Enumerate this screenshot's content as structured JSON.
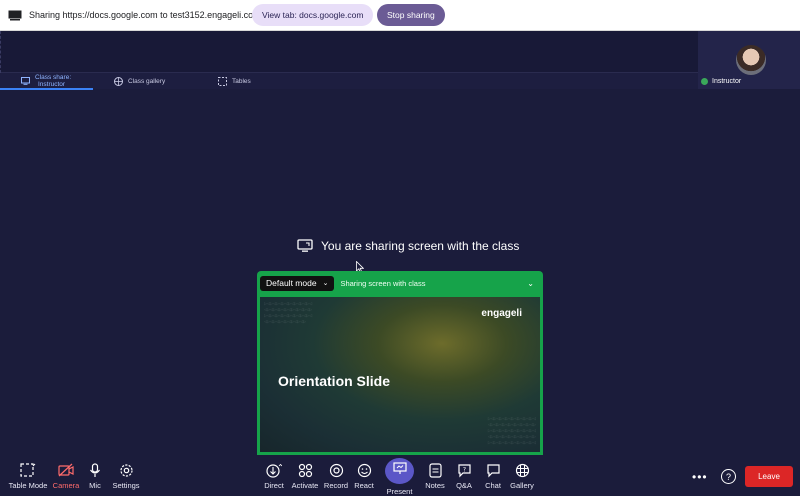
{
  "share_bar": {
    "text": "Sharing https://docs.google.com to test3152.engageli.com",
    "view_tab_label": "View tab: docs.google.com",
    "stop_label": "Stop sharing"
  },
  "instructor": {
    "label": "Instructor"
  },
  "tabs": [
    {
      "line1": "Class share:",
      "line2": "Instructor",
      "icon": "screen-share-icon",
      "active": true
    },
    {
      "label": "Class gallery",
      "icon": "grid-icon",
      "active": false
    },
    {
      "label": "Tables",
      "icon": "tables-icon",
      "active": false
    }
  ],
  "main": {
    "message": "You are sharing screen with the class"
  },
  "panel": {
    "mode": "Default mode",
    "status": "Sharing screen with class",
    "slide_logo": "engageli",
    "slide_title": "Orientation Slide"
  },
  "toolbar": {
    "table_mode": "Table Mode",
    "camera": "Camera",
    "mic": "Mic",
    "settings": "Settings",
    "direct": "Direct",
    "activate": "Activate",
    "record": "Record",
    "react": "React",
    "present": "Present",
    "notes": "Notes",
    "qa": "Q&A",
    "chat": "Chat",
    "gallery": "Gallery",
    "leave": "Leave"
  },
  "colors": {
    "accent_green": "#16a34a",
    "leave_red": "#dc2626",
    "present_purple": "#5b57c7"
  }
}
